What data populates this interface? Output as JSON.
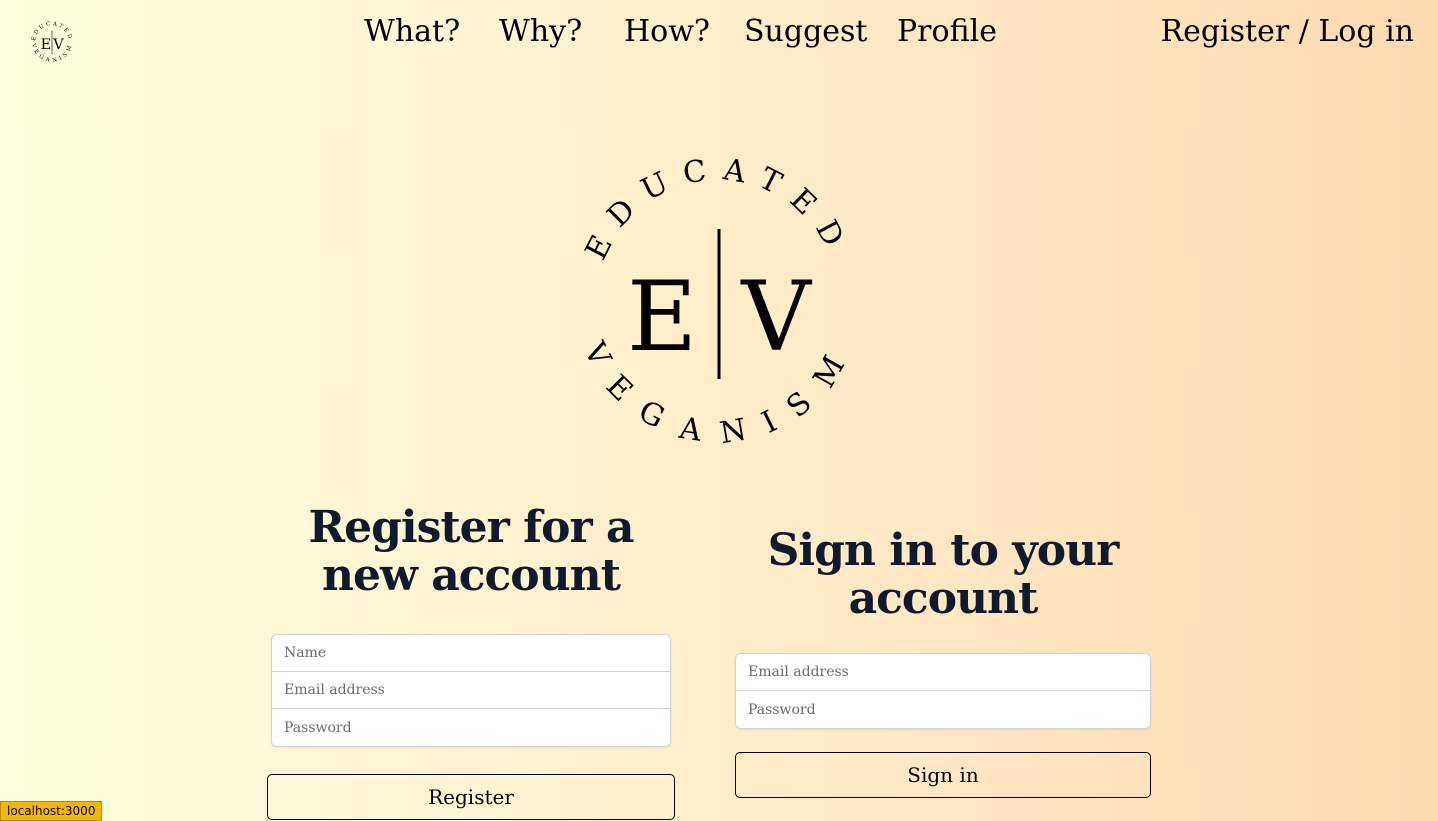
{
  "brand": {
    "logo_top_text": "EDUCATED",
    "logo_bottom_text": "VEGANISM",
    "logo_initial_left": "E",
    "logo_initial_right": "V"
  },
  "nav": {
    "items": [
      {
        "label": "What?"
      },
      {
        "label": "Why?"
      },
      {
        "label": "How?"
      },
      {
        "label": "Suggest"
      },
      {
        "label": "Profile"
      }
    ],
    "auth_label": "Register / Log in"
  },
  "register": {
    "heading_line1": "Register for a",
    "heading_line2": "new account",
    "name_placeholder": "Name",
    "email_placeholder": "Email address",
    "password_placeholder": "Password",
    "button_label": "Register"
  },
  "signin": {
    "heading_line1": "Sign in to your",
    "heading_line2": "account",
    "email_placeholder": "Email address",
    "password_placeholder": "Password",
    "button_label": "Sign in"
  },
  "status_bar": {
    "url": "localhost:3000"
  }
}
